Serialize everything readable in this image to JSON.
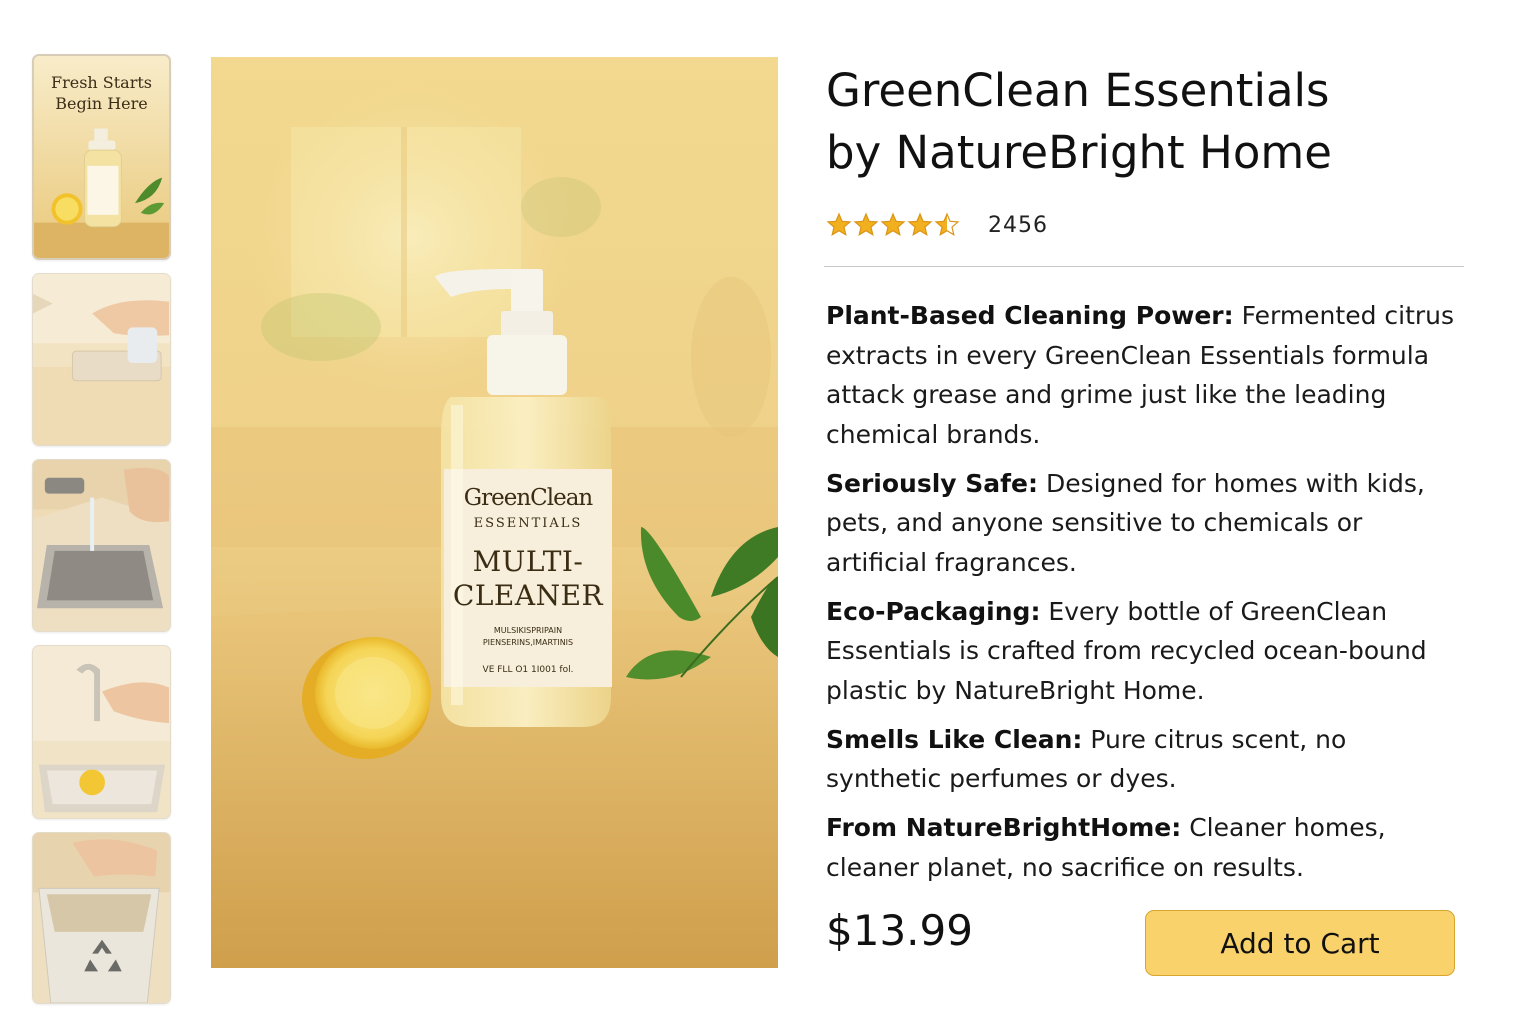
{
  "gallery": {
    "thumbnails": [
      {
        "caption_line1": "Fresh Starts",
        "caption_line2": "Begin Here"
      },
      {},
      {},
      {},
      {}
    ],
    "main_image_label": {
      "brand": "GreenClean",
      "subtitle": "ESSENTIALS",
      "product_line1": "MULTI-",
      "product_line2": "CLEANER",
      "fine_print_line1": "MULSIKISPRIPAIN",
      "fine_print_line2": "PIENSERINS,IMARTINIS",
      "volume": "VE FLL O1 1I001 fol."
    }
  },
  "product": {
    "title_line1": "GreenClean Essentials",
    "title_line2": "by NatureBright Home",
    "rating": 4.5,
    "rating_max": 5,
    "review_count": "2456",
    "bullets": [
      {
        "heading": "Plant-Based Cleaning Power:",
        "text": " Fermented citrus extracts in every GreenClean Essentials formula attack grease and grime just like the leading chemical brands."
      },
      {
        "heading": "Seriously Safe:",
        "text": "  Designed for homes with kids, pets, and anyone sensitive to chemicals or artificial fragrances."
      },
      {
        "heading": "Eco-Packaging:",
        "text": " Every bottle of GreenClean Essentials is crafted from recycled ocean-bound plastic by NatureBright Home."
      },
      {
        "heading": "Smells Like Clean:",
        "text": " Pure citrus scent, no synthetic perfumes or dyes."
      },
      {
        "heading": "From NatureBrightHome:",
        "text": " Cleaner homes, cleaner planet, no sacrifice on results."
      }
    ],
    "price": "$13.99",
    "add_to_cart_label": "Add to Cart"
  },
  "colors": {
    "star": "#f2b01e",
    "button": "#f9d26b",
    "button_border": "#d7a631",
    "divider": "#c9c9c9"
  }
}
